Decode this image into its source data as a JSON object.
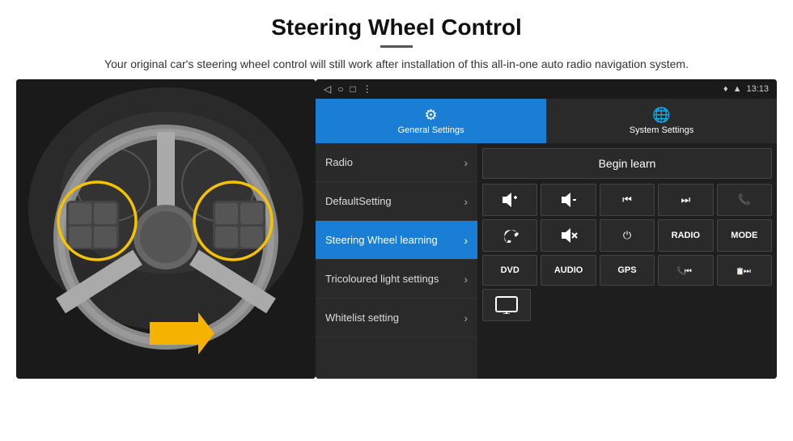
{
  "header": {
    "title": "Steering Wheel Control",
    "divider": true,
    "subtitle": "Your original car's steering wheel control will still work after installation of this all-in-one auto radio navigation system."
  },
  "statusBar": {
    "backIcon": "◁",
    "homeIcon": "○",
    "recentIcon": "□",
    "menuIcon": "⋮",
    "locationIcon": "♦",
    "signalIcon": "▲",
    "batteryIcon": "▮",
    "time": "13:13"
  },
  "tabs": [
    {
      "id": "general",
      "label": "General Settings",
      "icon": "⚙",
      "active": true
    },
    {
      "id": "system",
      "label": "System Settings",
      "icon": "🌐",
      "active": false
    }
  ],
  "menuItems": [
    {
      "id": "radio",
      "label": "Radio",
      "active": false
    },
    {
      "id": "defaultsetting",
      "label": "DefaultSetting",
      "active": false
    },
    {
      "id": "steering",
      "label": "Steering Wheel learning",
      "active": true
    },
    {
      "id": "tricoloured",
      "label": "Tricoloured light settings",
      "active": false
    },
    {
      "id": "whitelist",
      "label": "Whitelist setting",
      "active": false
    }
  ],
  "buttons": {
    "beginLearn": "Begin learn",
    "row1": [
      "🔊+",
      "🔊-",
      "⏮",
      "⏭",
      "📞"
    ],
    "row2": [
      "📞↩",
      "🔇",
      "⏻",
      "RADIO",
      "MODE"
    ],
    "row3": [
      "DVD",
      "AUDIO",
      "GPS",
      "📞⏮",
      "📋⏭"
    ],
    "row4": [
      "🖥"
    ]
  }
}
